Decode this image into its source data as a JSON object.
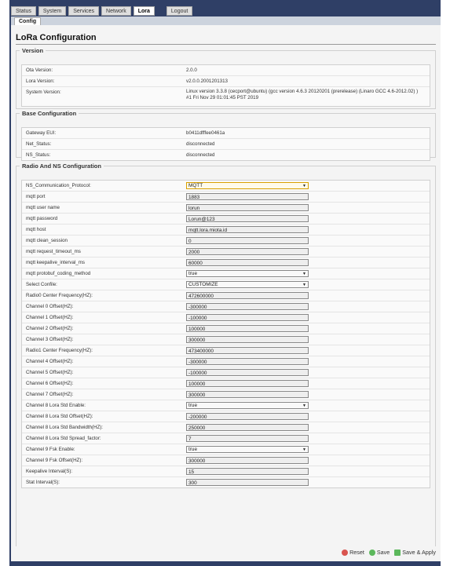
{
  "nav": {
    "tabs": [
      "Status",
      "System",
      "Services",
      "Network",
      "Lora",
      "Logout"
    ],
    "active_tab": "Lora",
    "subtab": "Config"
  },
  "page_title": "LoRa Configuration",
  "version": {
    "legend": "Version",
    "rows": [
      {
        "label": "Ota Version:",
        "value": "2.0.0"
      },
      {
        "label": "Lora Version:",
        "value": "v2.0.0.2001201313"
      },
      {
        "label": "System Version:",
        "value": "Linux version 3.3.8 (cecport@ubuntu) (gcc version 4.6.3 20120201 (prerelease) (Linaro GCC 4.6-2012.02) ) #1 Fri Nov 29 01:01:45 PST 2019"
      }
    ]
  },
  "base": {
    "legend": "Base Configuration",
    "rows": [
      {
        "label": "Gateway EUI:",
        "value": "b0411dfffee0461a"
      },
      {
        "label": "Net_Status:",
        "value": "disconnected"
      },
      {
        "label": "NS_Status:",
        "value": "disconnected"
      }
    ]
  },
  "radio": {
    "legend": "Radio And NS Configuration",
    "rows": [
      {
        "label": "NS_Communication_Protocol:",
        "type": "select",
        "value": "MQTT",
        "highlight": true
      },
      {
        "label": "mqtt port",
        "type": "input",
        "value": "1883"
      },
      {
        "label": "mqtt user name",
        "type": "input",
        "value": "lorun"
      },
      {
        "label": "mqtt password",
        "type": "input",
        "value": "Lorun@123"
      },
      {
        "label": "mqtt host",
        "type": "input",
        "value": "mqtt.lora.miota.id"
      },
      {
        "label": "mqtt clean_session",
        "type": "input",
        "value": "0"
      },
      {
        "label": "mqtt request_timeout_ms",
        "type": "input",
        "value": "2000"
      },
      {
        "label": "mqtt keepalive_interval_ms",
        "type": "input",
        "value": "60000"
      },
      {
        "label": "mqtt protobuf_coding_method",
        "type": "select",
        "value": "true"
      },
      {
        "label": "Select Confile:",
        "type": "select",
        "value": "CUSTOMIZE"
      },
      {
        "label": "Radio0 Center Frequency(HZ):",
        "type": "input",
        "value": "472600000"
      },
      {
        "label": "Channel 0 Offset(HZ):",
        "type": "input",
        "value": "-300000"
      },
      {
        "label": "Channel 1 Offset(HZ):",
        "type": "input",
        "value": "-100000"
      },
      {
        "label": "Channel 2 Offset(HZ):",
        "type": "input",
        "value": "100000"
      },
      {
        "label": "Channel 3 Offset(HZ):",
        "type": "input",
        "value": "300000"
      },
      {
        "label": "Radio1 Center Frequency(HZ):",
        "type": "input",
        "value": "473400000"
      },
      {
        "label": "Channel 4 Offset(HZ):",
        "type": "input",
        "value": "-300000"
      },
      {
        "label": "Channel 5 Offset(HZ):",
        "type": "input",
        "value": "-100000"
      },
      {
        "label": "Channel 6 Offset(HZ):",
        "type": "input",
        "value": "100000"
      },
      {
        "label": "Channel 7 Offset(HZ):",
        "type": "input",
        "value": "300000"
      },
      {
        "label": "Channel 8 Lora Std Enable:",
        "type": "select",
        "value": "true"
      },
      {
        "label": "Channel 8 Lora Std Offset(HZ):",
        "type": "input",
        "value": "-200000"
      },
      {
        "label": "Channel 8 Lora Std Bandwidth(HZ):",
        "type": "input",
        "value": "250000"
      },
      {
        "label": "Channel 8 Lora Std Spread_factor:",
        "type": "input",
        "value": "7"
      },
      {
        "label": "Channel 9 Fsk Enable:",
        "type": "select",
        "value": "true"
      },
      {
        "label": "Channel 9 Fsk Offset(HZ):",
        "type": "input",
        "value": "300000"
      },
      {
        "label": "Keepalive Interval(S):",
        "type": "input",
        "value": "15"
      },
      {
        "label": "Stat Interval(S):",
        "type": "input",
        "value": "300"
      }
    ]
  },
  "footer": {
    "reset_label": "Reset",
    "save_label": "Save",
    "apply_label": "Save & Apply"
  }
}
